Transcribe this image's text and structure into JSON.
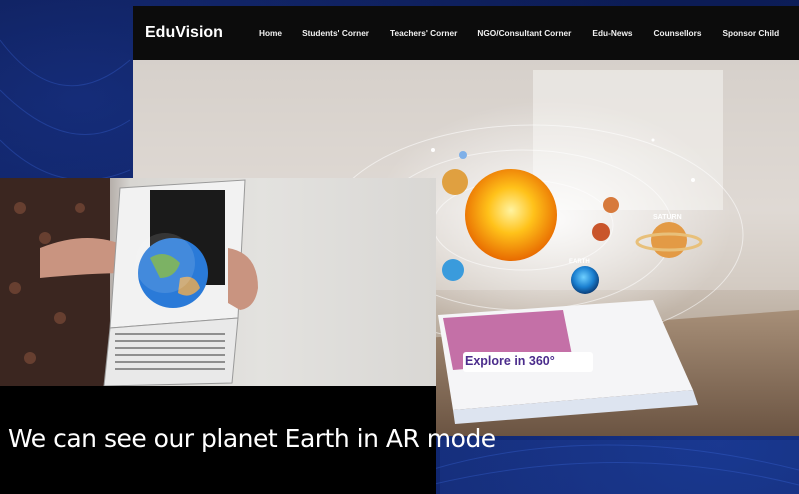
{
  "site": {
    "brand": "EduVision",
    "nav": [
      "Home",
      "Students' Corner",
      "Teachers' Corner",
      "NGO/Consultant Corner",
      "Edu-News",
      "Counsellors",
      "Sponsor Child"
    ],
    "hero": {
      "book_text": "Explore in 360°",
      "planet_labels": [
        "SATURN",
        "EARTH"
      ]
    }
  },
  "video": {
    "caption": "We can see our planet Earth in AR mode"
  }
}
